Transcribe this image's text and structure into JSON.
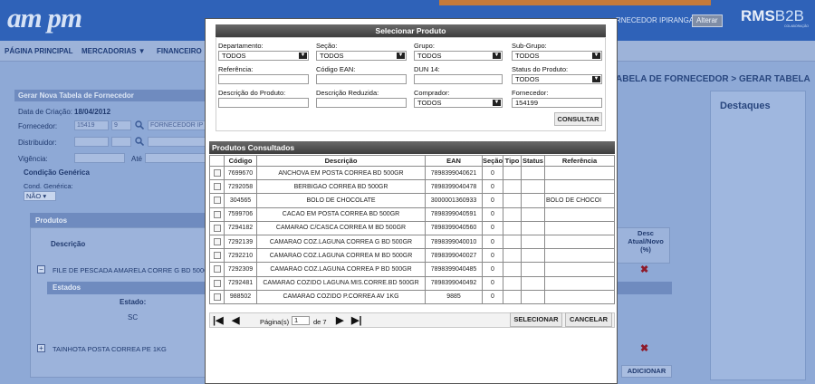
{
  "header": {
    "logo_a": "am",
    "logo_b": "pm",
    "supplier": "RNECEDOR IPIRANGA",
    "alter_label": "Alterar",
    "rms_a": "RMS",
    "rms_b": "B2B",
    "rms_sub": "COLABORAÇÃO"
  },
  "nav": {
    "items": [
      "PÁGINA PRINCIPAL",
      "MERCADORIAS ▼",
      "FINANCEIRO ▼"
    ]
  },
  "breadcrumb": "ABELA DE FORNECEDOR > GERAR TABELA",
  "destaques": "Destaques",
  "form": {
    "panel_title": "Gerar Nova Tabela de Fornecedor",
    "created_label": "Data de Criação:",
    "created_value": "18/04/2012",
    "fornecedor_label": "Fornecedor:",
    "fornecedor_code": "15419",
    "fornecedor_digit": "9",
    "fornecedor_name": "FORNECEDOR IP",
    "distribuidor_label": "Distribuidor:",
    "vigencia_label": "Vigência:",
    "ate_label": "Até",
    "cond_title": "Condição Genérica",
    "cond_sub": "Cond. Genérica:",
    "cond_value": "NÃO"
  },
  "produtos": {
    "title": "Produtos",
    "desc_col": "Descrição",
    "row1": "FILE DE PESCADA AMARELA CORRE G BD 500G",
    "estados_title": "Estados",
    "estado_col": "Estado:",
    "estado_val": "SC",
    "row2": "TAINHOTA POSTA CORREA PE 1KG",
    "right_desc": "Desc Atual/Novo (%)",
    "adicionar": "ADICIONAR",
    "x": "✖"
  },
  "modal": {
    "title": "Selecionar Produto",
    "departamento_label": "Departamento:",
    "departamento_value": "TODOS",
    "secao_label": "Seção:",
    "secao_value": "TODOS",
    "grupo_label": "Grupo:",
    "grupo_value": "TODOS",
    "subgrupo_label": "Sub-Grupo:",
    "subgrupo_value": "TODOS",
    "referencia_label": "Referência:",
    "ean_label": "Código EAN:",
    "dun_label": "DUN 14:",
    "status_label": "Status do Produto:",
    "status_value": "TODOS",
    "descricao_label": "Descrição do Produto:",
    "desc_reduzida_label": "Descrição Reduzida:",
    "comprador_label": "Comprador:",
    "comprador_value": "TODOS",
    "fornecedor_label": "Fornecedor:",
    "fornecedor_value": "154199",
    "consultar": "CONSULTAR",
    "results_title": "Produtos Consultados",
    "columns": [
      "",
      "Código",
      "Descrição",
      "EAN",
      "Seção",
      "Tipo",
      "Status",
      "Referência"
    ],
    "rows": [
      {
        "codigo": "7699670",
        "descricao": "ANCHOVA EM POSTA CORREA BD 500GR",
        "ean": "7898399040621",
        "secao": "0",
        "tipo": "",
        "status": "",
        "referencia": ""
      },
      {
        "codigo": "7292058",
        "descricao": "BERBIGAO CORREA BD 500GR",
        "ean": "7898399040478",
        "secao": "0",
        "tipo": "",
        "status": "",
        "referencia": ""
      },
      {
        "codigo": "304565",
        "descricao": "BOLO DE CHOCOLATE",
        "ean": "3000001360933",
        "secao": "0",
        "tipo": "",
        "status": "",
        "referencia": "BOLO DE CHOCOI"
      },
      {
        "codigo": "7599706",
        "descricao": "CACAO EM POSTA CORREA BD 500GR",
        "ean": "7898399040591",
        "secao": "0",
        "tipo": "",
        "status": "",
        "referencia": ""
      },
      {
        "codigo": "7294182",
        "descricao": "CAMARAO C/CASCA CORREA M BD 500GR",
        "ean": "7898399040560",
        "secao": "0",
        "tipo": "",
        "status": "",
        "referencia": ""
      },
      {
        "codigo": "7292139",
        "descricao": "CAMARAO COZ.LAGUNA CORREA G BD 500GR",
        "ean": "7898399040010",
        "secao": "0",
        "tipo": "",
        "status": "",
        "referencia": ""
      },
      {
        "codigo": "7292210",
        "descricao": "CAMARAO COZ.LAGUNA CORREA M BD 500GR",
        "ean": "7898399040027",
        "secao": "0",
        "tipo": "",
        "status": "",
        "referencia": ""
      },
      {
        "codigo": "7292309",
        "descricao": "CAMARAO COZ.LAGUNA CORREA P BD 500GR",
        "ean": "7898399040485",
        "secao": "0",
        "tipo": "",
        "status": "",
        "referencia": ""
      },
      {
        "codigo": "7292481",
        "descricao": "CAMARAO COZIDO LAGUNA MIS.CORRE.BD 500GR",
        "ean": "7898399040492",
        "secao": "0",
        "tipo": "",
        "status": "",
        "referencia": ""
      },
      {
        "codigo": "988502",
        "descricao": "CAMARAO COZIDO P.CORREA AV 1KG",
        "ean": "9885",
        "secao": "0",
        "tipo": "",
        "status": "",
        "referencia": ""
      }
    ],
    "pager": {
      "page_label": "Página(s)",
      "page_value": "1",
      "of_label": "de 7"
    },
    "selecionar": "SELECIONAR",
    "cancelar": "CANCELAR"
  }
}
